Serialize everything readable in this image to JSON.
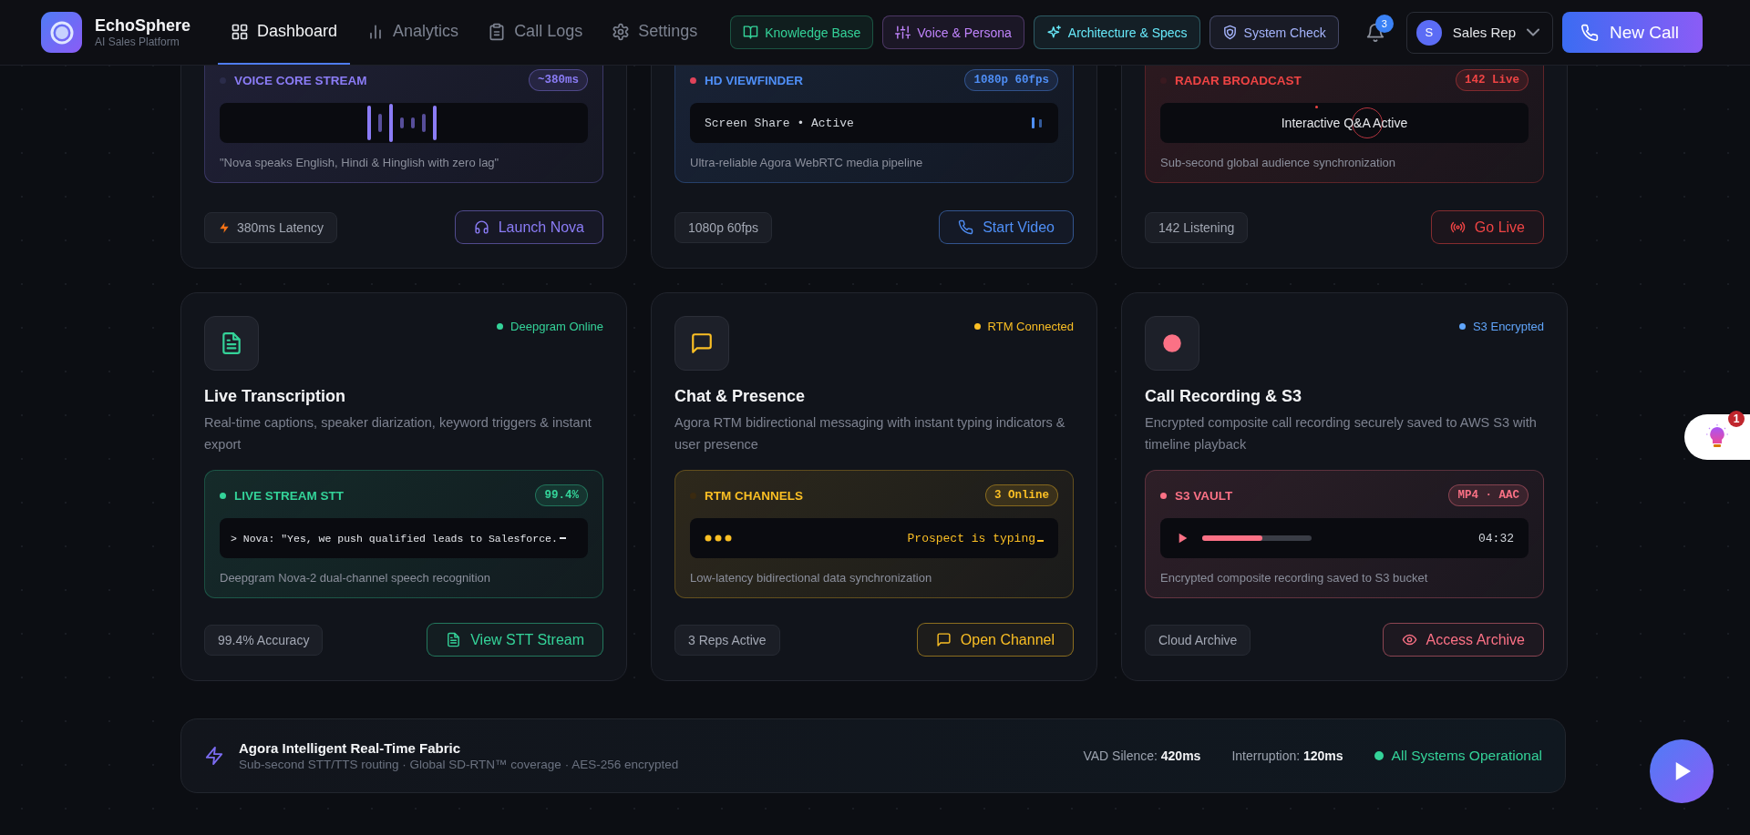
{
  "nav": {
    "logo": {
      "title": "EchoSphere",
      "subtitle": "AI Sales Platform"
    },
    "tabs": [
      {
        "label": "Dashboard",
        "selected": true
      },
      {
        "label": "Analytics",
        "selected": false
      },
      {
        "label": "Call Logs",
        "selected": false
      },
      {
        "label": "Settings",
        "selected": false
      }
    ],
    "quick_links": [
      {
        "label": "Knowledge Base",
        "color": "#34d399"
      },
      {
        "label": "Voice & Persona",
        "color": "#c084fc"
      },
      {
        "label": "Architecture & Specs",
        "color": "#67e8f9"
      },
      {
        "label": "System Check",
        "color": "#a5b4fc"
      }
    ],
    "notifications": {
      "count": "3"
    },
    "user": {
      "initial": "S",
      "name": "Sales Rep"
    },
    "new_call": {
      "label": "New Call"
    }
  },
  "cards": [
    {
      "color": "#8b7cf6",
      "panel": {
        "kind": "waveform",
        "title": "VOICE CORE STREAM",
        "color": "#2b2c4a",
        "badge": "~380ms",
        "caption": "\"Nova speaks English, Hindi & Hinglish with zero lag\""
      },
      "footer": {
        "stat": "380ms Latency",
        "action": "Launch Nova"
      }
    },
    {
      "color": "#4f8ff7",
      "panel": {
        "kind": "screen",
        "title": "HD VIEWFINDER",
        "color": "#e0435a",
        "badge": "1080p 60fps",
        "text": "Screen Share • Active",
        "caption": "Ultra-reliable Agora WebRTC media pipeline"
      },
      "footer": {
        "stat": "1080p 60fps",
        "action": "Start Video"
      }
    },
    {
      "color": "#ef4444",
      "panel": {
        "kind": "radar",
        "title": "RADAR BROADCAST",
        "color": "#3a1a20",
        "badge": "142 Live",
        "text": "Interactive Q&A Active",
        "caption": "Sub-second global audience synchronization"
      },
      "footer": {
        "stat": "142 Listening",
        "action": "Go Live"
      }
    },
    {
      "color": "#34d399",
      "status": {
        "label": "Deepgram Online",
        "color": "#34d399"
      },
      "title": "Live Transcription",
      "description": "Real-time captions, speaker diarization, keyword triggers & instant export",
      "panel": {
        "kind": "terminal",
        "title": "LIVE STREAM STT",
        "color": "#34d399",
        "badge": "99.4%",
        "text": "> Nova: \"Yes, we push qualified leads to Salesforce.",
        "caption": "Deepgram Nova-2 dual-channel speech recognition"
      },
      "footer": {
        "stat": "99.4% Accuracy",
        "action": "View STT Stream"
      }
    },
    {
      "color": "#fbbf24",
      "status": {
        "label": "RTM Connected",
        "color": "#fbbf24"
      },
      "title": "Chat & Presence",
      "description": "Agora RTM bidirectional messaging with instant typing indicators & user presence",
      "panel": {
        "kind": "typing",
        "title": "RTM CHANNELS",
        "color": "#3a2a10",
        "badge": "3 Online",
        "text": "Prospect is typing",
        "caption": "Low-latency bidirectional data synchronization"
      },
      "footer": {
        "stat": "3 Reps Active",
        "action": "Open Channel"
      }
    },
    {
      "color": "#fb7185",
      "status": {
        "label": "S3 Encrypted",
        "color": "#60a5fa"
      },
      "title": "Call Recording & S3",
      "description": "Encrypted composite call recording securely saved to AWS S3 with timeline playback",
      "panel": {
        "kind": "player",
        "title": "S3 VAULT",
        "color": "#fb7185",
        "badge": "MP4 · AAC",
        "level": 0.55,
        "time": "04:32",
        "caption": "Encrypted composite recording saved to S3 bucket"
      },
      "footer": {
        "stat": "Cloud Archive",
        "action": "Access Archive"
      }
    }
  ],
  "fabric_bar": {
    "title": "Agora Intelligent Real-Time Fabric",
    "subtitle": "Sub-second STT/TTS routing · Global SD-RTN™ coverage · AES-256 encrypted",
    "metrics": [
      {
        "label": "VAD Silence:",
        "value": "420ms"
      },
      {
        "label": "Interruption:",
        "value": "120ms"
      }
    ],
    "status": "All Systems Operational"
  },
  "assistant_widget": {
    "badge": "1"
  }
}
